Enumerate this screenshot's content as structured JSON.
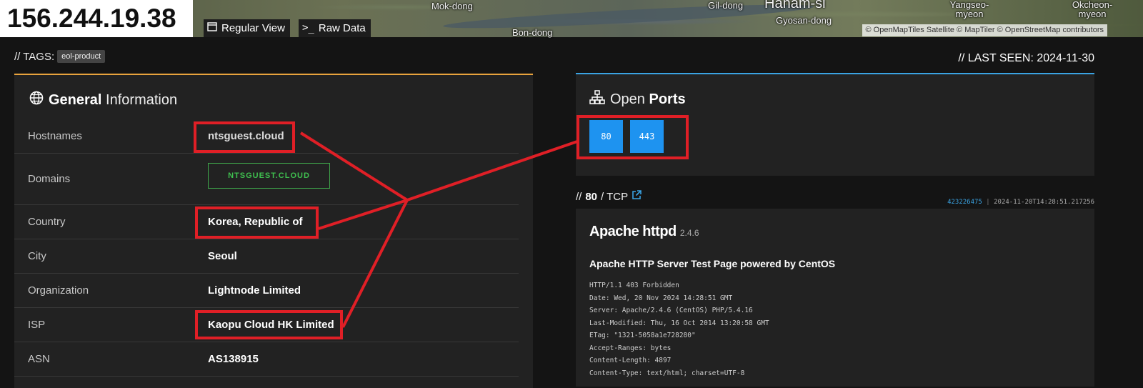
{
  "header": {
    "ip": "156.244.19.38",
    "regular_view_label": "Regular View",
    "raw_data_label": "Raw Data",
    "map_labels": [
      "Mok-dong",
      "Bon-dong",
      "Gil-dong",
      "Hanam-si",
      "Gyosan-dong",
      "Yangseo-myeon",
      "Okcheon-myeon"
    ],
    "attribution": "© OpenMapTiles Satellite  © MapTiler © OpenStreetMap contributors"
  },
  "tags": {
    "prefix": "// TAGS:",
    "items": [
      "eol-product"
    ]
  },
  "last_seen": "// LAST SEEN: 2024-11-30",
  "general": {
    "title_bold": "General",
    "title_rest": "Information",
    "rows": [
      {
        "label": "Hostnames",
        "value": "ntsguest.cloud"
      },
      {
        "label": "Domains",
        "value": "NTSGUEST.CLOUD"
      },
      {
        "label": "Country",
        "value": "Korea, Republic of"
      },
      {
        "label": "City",
        "value": "Seoul"
      },
      {
        "label": "Organization",
        "value": "Lightnode Limited"
      },
      {
        "label": "ISP",
        "value": "Kaopu Cloud HK Limited"
      },
      {
        "label": "ASN",
        "value": "AS138915"
      }
    ]
  },
  "ports": {
    "title_rest": "Open",
    "title_bold": "Ports",
    "items": [
      "80",
      "443"
    ]
  },
  "service": {
    "prefix": "//",
    "port": "80",
    "proto": "/ TCP",
    "hash": "423226475",
    "timestamp": "2024-11-20T14:28:51.217256",
    "product": "Apache httpd",
    "version": "2.4.6",
    "page_title": "Apache HTTP Server Test Page powered by CentOS",
    "banner": "HTTP/1.1 403 Forbidden\nDate: Wed, 20 Nov 2024 14:28:51 GMT\nServer: Apache/2.4.6 (CentOS) PHP/5.4.16\nLast-Modified: Thu, 16 Oct 2014 13:20:58 GMT\nETag: \"1321-5058a1e728280\"\nAccept-Ranges: bytes\nContent-Length: 4897\nContent-Type: text/html; charset=UTF-8"
  },
  "colors": {
    "accent_orange": "#e8a33d",
    "accent_blue": "#3aa3e3",
    "port_blue": "#1e93f0",
    "domain_green": "#3fbf4f",
    "annotation_red": "#e01f26"
  },
  "icons": [
    "window-icon",
    "terminal-icon",
    "globe-icon",
    "network-icon",
    "external-link-icon"
  ]
}
